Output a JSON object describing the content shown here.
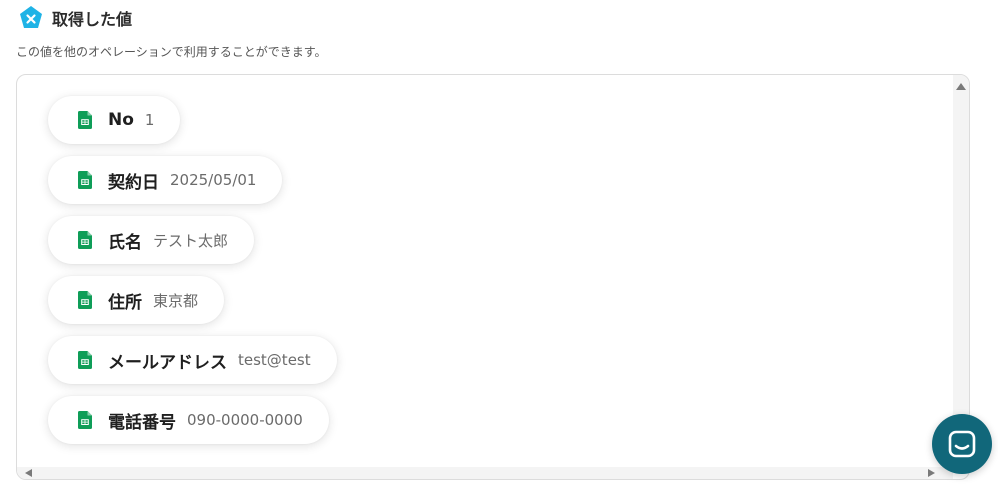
{
  "header": {
    "title": "取得した値",
    "icon": "yoom-logo-icon",
    "accent_color": "#1fb3e6"
  },
  "description": "この値を他のオペレーションで利用することができます。",
  "fields": [
    {
      "label": "No",
      "value": "1",
      "icon": "google-sheets-icon"
    },
    {
      "label": "契約日",
      "value": "2025/05/01",
      "icon": "google-sheets-icon"
    },
    {
      "label": "氏名",
      "value": "テスト太郎",
      "icon": "google-sheets-icon"
    },
    {
      "label": "住所",
      "value": "東京都",
      "icon": "google-sheets-icon"
    },
    {
      "label": "メールアドレス",
      "value": "test@test",
      "icon": "google-sheets-icon"
    },
    {
      "label": "電話番号",
      "value": "090-0000-0000",
      "icon": "google-sheets-icon"
    }
  ],
  "colors": {
    "sheets_green": "#0f9d58",
    "chat_button": "#11677a"
  },
  "chat": {
    "icon": "chat-icon"
  }
}
